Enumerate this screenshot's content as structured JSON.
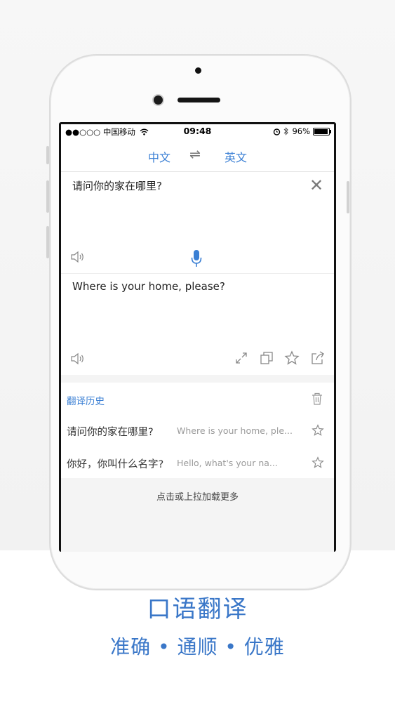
{
  "status_bar": {
    "carrier": "●●○○○ 中国移动",
    "time": "09:48",
    "battery": "96%",
    "battery_level": 0.96
  },
  "lang_bar": {
    "source_lang": "中文",
    "swap_symbol": "⇌",
    "target_lang": "英文"
  },
  "translator": {
    "source_text": "请问你的家在哪里?",
    "close_symbol": "✕",
    "target_text": "Where is your home, please?"
  },
  "history": {
    "title": "翻译历史",
    "items": [
      {
        "source": "请问你的家在哪里?",
        "target": "Where is your home, ple..."
      },
      {
        "source": "你好，你叫什么名字?",
        "target": "Hello, what's your na..."
      }
    ],
    "load_more": "点击或上拉加载更多"
  },
  "caption": {
    "title": "口语翻译",
    "subtitle": "准确 • 通顺 • 优雅"
  },
  "colors": {
    "accent": "#3a7fd4",
    "caption": "#3a77c8"
  },
  "icons": [
    "wifi-icon",
    "alarm-icon",
    "bluetooth-icon",
    "battery-icon",
    "swap-icon",
    "close-icon",
    "speaker-icon",
    "microphone-icon",
    "expand-icon",
    "copy-icon",
    "star-icon",
    "share-icon",
    "trash-icon"
  ]
}
